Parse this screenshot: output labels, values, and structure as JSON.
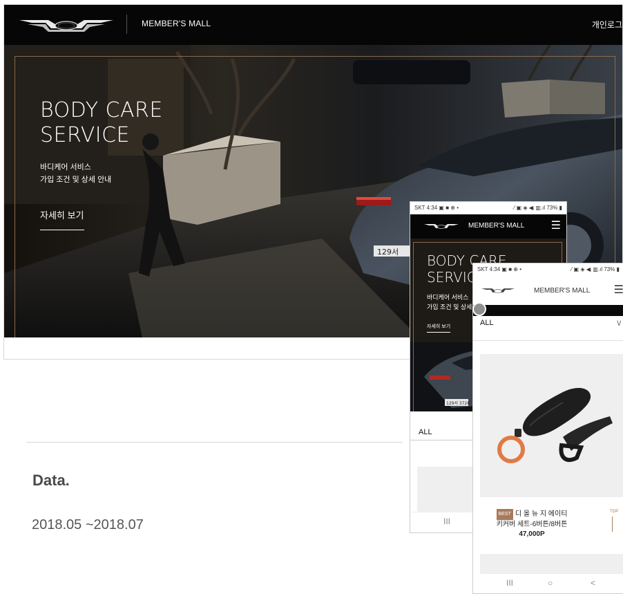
{
  "desktop": {
    "mall_label": "MEMBER'S MALL",
    "login_label": "개인로그",
    "hero": {
      "title_line1": "BODY CARE",
      "title_line2": "SERVICE",
      "subtitle_line1": "바디케어 서비스",
      "subtitle_line2": "가입 조건 및 상세 안내",
      "more_label": "자세히 보기"
    }
  },
  "project": {
    "label": "Data.",
    "period": "2018.05  ~2018.07"
  },
  "phone1": {
    "status_left": "SKT 4:34 ▣ ■ ⊕ •",
    "status_right": "⁄ ▣ ◈ ◀ᵢ ▥.ıl 73% ▮",
    "mall_label": "MEMBER'S MALL",
    "menu_icon": "☰",
    "hero": {
      "title_line1": "BODY CARE",
      "title_line2": "SERVICE",
      "subtitle_line1": "바디케어 서비스",
      "subtitle_line2": "가입 조건 및 상세 안내",
      "more_label": "자세히 보기"
    },
    "filter_label": "ALL",
    "nav_recent": "III"
  },
  "phone2": {
    "status_left": "SKT 4:34 ▣ ■ ⊕ •",
    "status_right": "⁄ ▣ ◈ ◀ᵢ ▥.ıl 73% ▮",
    "mall_label": "MEMBER'S MALL",
    "menu_icon": "☰",
    "filter_label": "ALL",
    "filter_chevron": "∨",
    "product": {
      "badge": "BEST",
      "name_line1": "디 올 뉴 지 에이티",
      "name_line2": "키커버 세트-6버튼/8버튼",
      "price": "47,000P"
    },
    "top_label": "TOP",
    "nav_recent": "III",
    "nav_home": "○",
    "nav_back": "<"
  },
  "colors": {
    "header_black": "#060606",
    "accent_bronze": "#a77a5a",
    "hero_frame": "#8a6a4e"
  }
}
